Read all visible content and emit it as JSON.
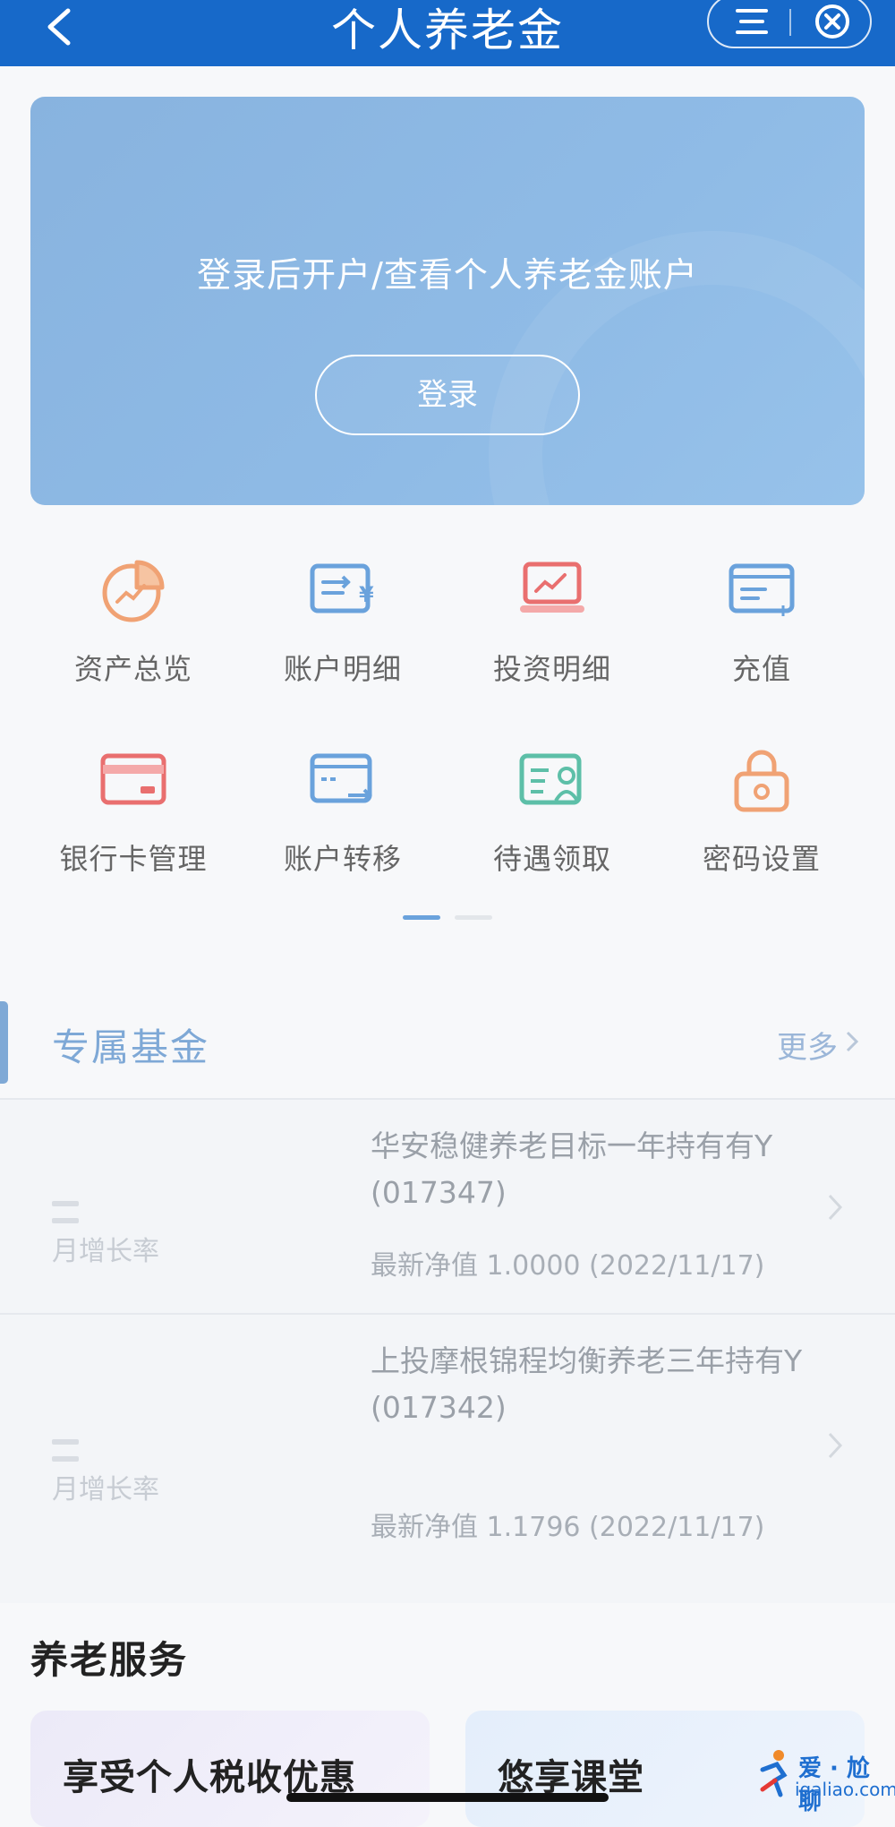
{
  "header": {
    "title": "个人养老金"
  },
  "hero": {
    "text": "登录后开户/查看个人养老金账户",
    "login_label": "登录"
  },
  "functions": [
    {
      "label": "资产总览",
      "icon": "pie-chart-icon"
    },
    {
      "label": "账户明细",
      "icon": "transfer-card-icon"
    },
    {
      "label": "投资明细",
      "icon": "laptop-chart-icon"
    },
    {
      "label": "充值",
      "icon": "card-plus-icon"
    },
    {
      "label": "银行卡管理",
      "icon": "bank-card-icon"
    },
    {
      "label": "账户转移",
      "icon": "card-arrow-icon"
    },
    {
      "label": "待遇领取",
      "icon": "person-card-icon"
    },
    {
      "label": "密码设置",
      "icon": "lock-icon"
    }
  ],
  "funds": {
    "title": "专属基金",
    "more": "更多",
    "items": [
      {
        "rate": "— —",
        "rate_label": "月增长率",
        "name": "华安稳健养老目标一年持有有Y (017347)",
        "nav": "最新净值  1.0000 (2022/11/17)"
      },
      {
        "rate": "— —",
        "rate_label": "月增长率",
        "name": "上投摩根锦程均衡养老三年持有Y (017342)",
        "nav": "最新净值  1.1796 (2022/11/17)"
      }
    ]
  },
  "services": {
    "title": "养老服务",
    "cards": [
      {
        "label": "享受个人税收优惠"
      },
      {
        "label": "悠享课堂"
      }
    ]
  },
  "watermark": {
    "line1": "爱 · 尬聊",
    "line2": "igaliao.com"
  },
  "colors": {
    "header_bg": "#1769c9",
    "hero_bg": "#8fbbe6",
    "accent": "#7ea8d6"
  }
}
